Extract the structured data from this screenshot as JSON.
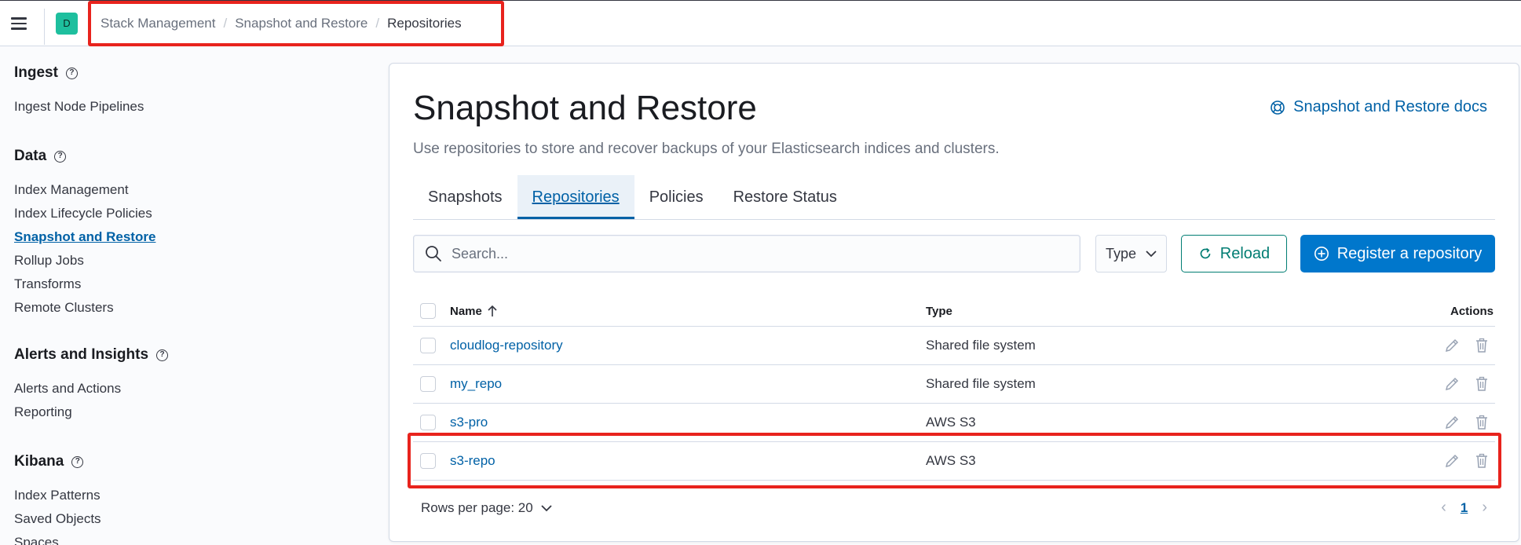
{
  "header": {
    "space_initial": "D",
    "breadcrumbs": [
      "Stack Management",
      "Snapshot and Restore",
      "Repositories"
    ]
  },
  "sidebar": {
    "groups": [
      {
        "title": "Ingest",
        "items": [
          "Ingest Node Pipelines"
        ]
      },
      {
        "title": "Data",
        "items": [
          "Index Management",
          "Index Lifecycle Policies",
          "Snapshot and Restore",
          "Rollup Jobs",
          "Transforms",
          "Remote Clusters"
        ]
      },
      {
        "title": "Alerts and Insights",
        "items": [
          "Alerts and Actions",
          "Reporting"
        ]
      },
      {
        "title": "Kibana",
        "items": [
          "Index Patterns",
          "Saved Objects",
          "Spaces"
        ]
      }
    ],
    "active_item": "Snapshot and Restore"
  },
  "main": {
    "title": "Snapshot and Restore",
    "description": "Use repositories to store and recover backups of your Elasticsearch indices and clusters.",
    "docs_link": "Snapshot and Restore docs",
    "tabs": [
      "Snapshots",
      "Repositories",
      "Policies",
      "Restore Status"
    ],
    "active_tab": "Repositories",
    "search_placeholder": "Search...",
    "type_filter": "Type",
    "reload_label": "Reload",
    "register_label": "Register a repository"
  },
  "table": {
    "columns": {
      "name": "Name",
      "type": "Type",
      "actions": "Actions"
    },
    "rows": [
      {
        "name": "cloudlog-repository",
        "type": "Shared file system"
      },
      {
        "name": "my_repo",
        "type": "Shared file system"
      },
      {
        "name": "s3-pro",
        "type": "AWS S3"
      },
      {
        "name": "s3-repo",
        "type": "AWS S3"
      }
    ]
  },
  "pagination": {
    "rows_per_page": "Rows per page: 20",
    "current_page": "1"
  },
  "colors": {
    "primary": "#0077cc",
    "link": "#0061a6",
    "success": "#017d73",
    "highlight": "#e8231d"
  }
}
